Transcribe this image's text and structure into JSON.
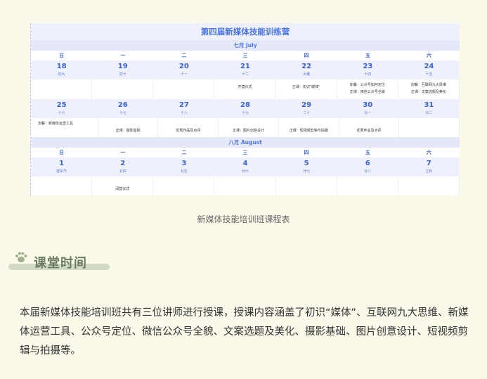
{
  "calendar": {
    "title": "第四届新媒体技能训练营",
    "weekdays": [
      "日",
      "一",
      "二",
      "三",
      "四",
      "五",
      "六"
    ],
    "july": {
      "label": "七月 July",
      "week1": {
        "days": [
          {
            "num": "18",
            "lunar": "初九"
          },
          {
            "num": "19",
            "lunar": "初十"
          },
          {
            "num": "20",
            "lunar": "十一"
          },
          {
            "num": "21",
            "lunar": "十二"
          },
          {
            "num": "22",
            "lunar": "大暑"
          },
          {
            "num": "23",
            "lunar": "十四"
          },
          {
            "num": "24",
            "lunar": "十五"
          }
        ],
        "events": [
          "",
          "",
          "",
          "开营仪式",
          "正课：初识\"媒体\"",
          "加餐：公众号如何定位\n正课：微信公众号全貌",
          "加餐：互联网九大思维\n正课：文案选题及美化"
        ]
      },
      "week2": {
        "days": [
          {
            "num": "25",
            "lunar": "十六"
          },
          {
            "num": "26",
            "lunar": "十七"
          },
          {
            "num": "27",
            "lunar": "十八"
          },
          {
            "num": "28",
            "lunar": "十九"
          },
          {
            "num": "29",
            "lunar": "二十"
          },
          {
            "num": "30",
            "lunar": "廿一"
          },
          {
            "num": "31",
            "lunar": "廿二"
          }
        ],
        "events": [
          "加餐：新媒体运营工具",
          "正课：摄影基础",
          "优秀作品及点评",
          "正课：图片创意设计",
          "正课：短视频剪辑与拍摄",
          "优秀作业及点评",
          ""
        ]
      }
    },
    "august": {
      "label": "八月 August",
      "week1": {
        "days": [
          {
            "num": "1",
            "lunar": "建军节"
          },
          {
            "num": "2",
            "lunar": "廿四"
          },
          {
            "num": "3",
            "lunar": "廿五"
          },
          {
            "num": "4",
            "lunar": "廿六"
          },
          {
            "num": "5",
            "lunar": "廿七"
          },
          {
            "num": "6",
            "lunar": "廿八"
          },
          {
            "num": "7",
            "lunar": "立秋"
          }
        ],
        "events": [
          "",
          "闭营仪式",
          "",
          "",
          "",
          "",
          ""
        ]
      }
    }
  },
  "caption": "新媒体技能培训班课程表",
  "section": {
    "title": "课堂时间",
    "icon": "paw-icon"
  },
  "body_text": "本届新媒体技能培训班共有三位讲师进行授课，授课内容涵盖了初识“媒体”、互联网九大思维、新媒体运营工具、公众号定位、微信公众号全貌、文案选题及美化、摄影基础、图片创意设计、短视频剪辑与拍摄等。"
}
